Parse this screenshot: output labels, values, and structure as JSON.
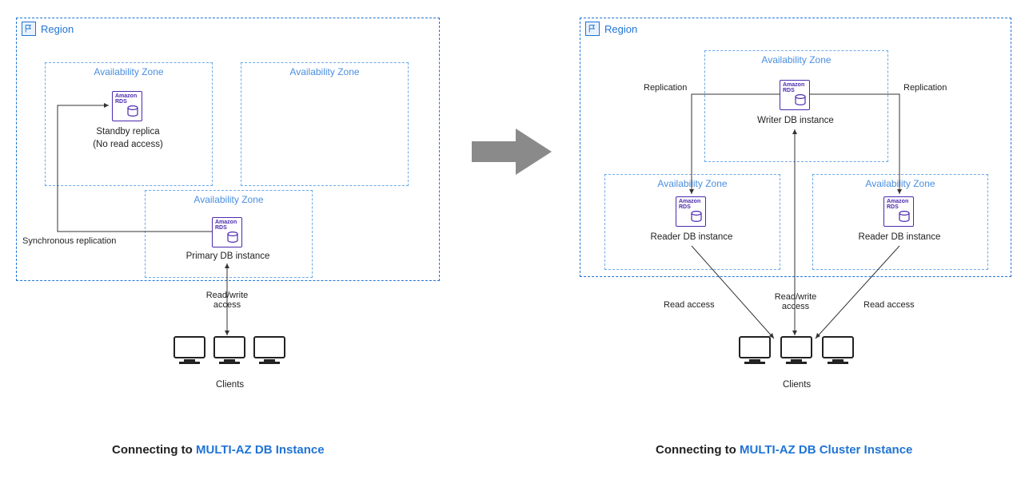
{
  "left": {
    "region_label": "Region",
    "az1_label": "Availability Zone",
    "az2_label": "Availability Zone",
    "az3_label": "Availability Zone",
    "rds_brand_line1": "Amazon",
    "rds_brand_line2": "RDS",
    "standby_label_line1": "Standby replica",
    "standby_label_line2": "(No read access)",
    "primary_label": "Primary DB instance",
    "sync_label": "Synchronous replication",
    "rw_label_line1": "Read/write",
    "rw_label_line2": "access",
    "clients_label": "Clients",
    "caption_prefix": "Connecting to ",
    "caption_highlight": "MULTI-AZ DB Instance"
  },
  "right": {
    "region_label": "Region",
    "az_top_label": "Availability Zone",
    "az_left_label": "Availability Zone",
    "az_right_label": "Availability Zone",
    "rds_brand_line1": "Amazon",
    "rds_brand_line2": "RDS",
    "writer_label": "Writer DB instance",
    "reader_label": "Reader DB instance",
    "replication_label": "Replication",
    "rw_label_line1": "Read/write",
    "rw_label_line2": "access",
    "read_access_label": "Read access",
    "clients_label": "Clients",
    "caption_prefix": "Connecting to ",
    "caption_highlight": "MULTI-AZ DB Cluster Instance"
  }
}
